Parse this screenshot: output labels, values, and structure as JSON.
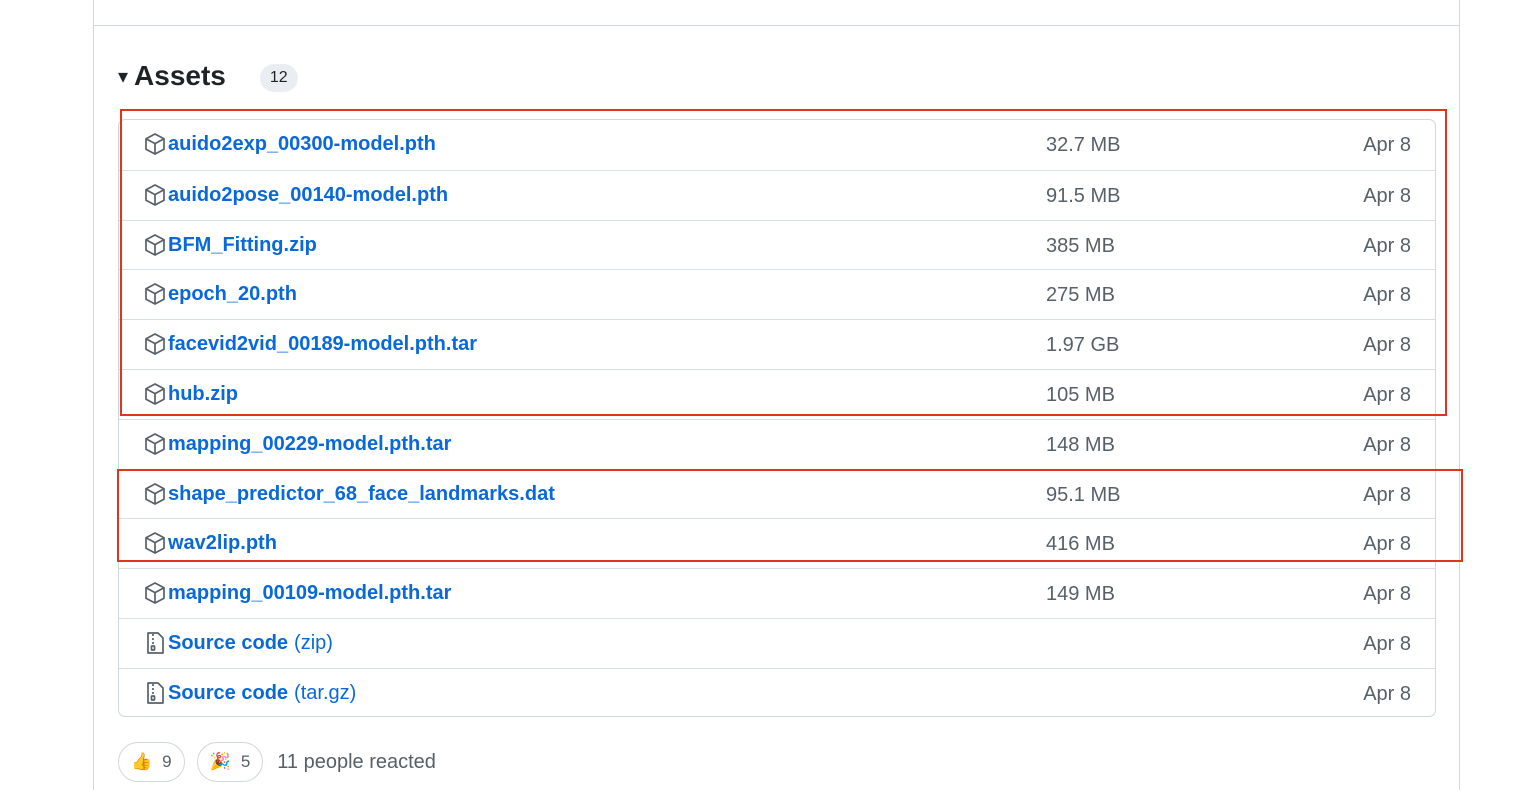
{
  "assets": {
    "title": "Assets",
    "count": "12",
    "caret_icon": "triangle-down-icon",
    "items": [
      {
        "name": "auido2exp_00300-model.pth",
        "suffix": "",
        "size": "32.7 MB",
        "date": "Apr 8",
        "icon": "package-icon"
      },
      {
        "name": "auido2pose_00140-model.pth",
        "suffix": "",
        "size": "91.5 MB",
        "date": "Apr 8",
        "icon": "package-icon"
      },
      {
        "name": "BFM_Fitting.zip",
        "suffix": "",
        "size": "385 MB",
        "date": "Apr 8",
        "icon": "package-icon"
      },
      {
        "name": "epoch_20.pth",
        "suffix": "",
        "size": "275 MB",
        "date": "Apr 8",
        "icon": "package-icon"
      },
      {
        "name": "facevid2vid_00189-model.pth.tar",
        "suffix": "",
        "size": "1.97 GB",
        "date": "Apr 8",
        "icon": "package-icon"
      },
      {
        "name": "hub.zip",
        "suffix": "",
        "size": "105 MB",
        "date": "Apr 8",
        "icon": "package-icon"
      },
      {
        "name": "mapping_00229-model.pth.tar",
        "suffix": "",
        "size": "148 MB",
        "date": "Apr 8",
        "icon": "package-icon"
      },
      {
        "name": "shape_predictor_68_face_landmarks.dat",
        "suffix": "",
        "size": "95.1 MB",
        "date": "Apr 8",
        "icon": "package-icon"
      },
      {
        "name": "wav2lip.pth",
        "suffix": "",
        "size": "416 MB",
        "date": "Apr 8",
        "icon": "package-icon"
      },
      {
        "name": "mapping_00109-model.pth.tar",
        "suffix": "",
        "size": "149 MB",
        "date": "Apr 8",
        "icon": "package-icon"
      },
      {
        "name": "Source code",
        "suffix": "(zip)",
        "size": "",
        "date": "Apr 8",
        "icon": "file-zip-icon"
      },
      {
        "name": "Source code",
        "suffix": "(tar.gz)",
        "size": "",
        "date": "Apr 8",
        "icon": "file-zip-icon"
      }
    ]
  },
  "highlight_color": "#e0341d",
  "link_color": "#0969da",
  "reactions": {
    "items": [
      {
        "icon": "thumbs-up-icon",
        "emoji": "👍",
        "count": "9"
      },
      {
        "icon": "party-popper-icon",
        "emoji": "🎉",
        "count": "5"
      }
    ],
    "summary": "11 people reacted"
  }
}
